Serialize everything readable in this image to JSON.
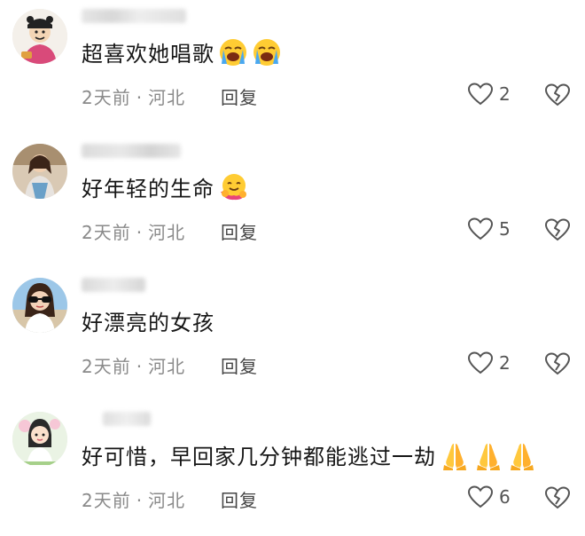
{
  "comments": [
    {
      "text": "超喜欢她唱歌",
      "emojis": [
        "loudly-crying-face-icon",
        "loudly-crying-face-icon"
      ],
      "time": "2天前",
      "location": "河北",
      "reply_label": "回复",
      "likes": "2"
    },
    {
      "text": "好年轻的生命",
      "emojis": [
        "hugging-face-icon"
      ],
      "time": "2天前",
      "location": "河北",
      "reply_label": "回复",
      "likes": "5"
    },
    {
      "text": "好漂亮的女孩",
      "emojis": [],
      "time": "2天前",
      "location": "河北",
      "reply_label": "回复",
      "likes": "2"
    },
    {
      "text": "好可惜，早回家几分钟都能逃过一劫",
      "emojis": [
        "folded-hands-icon",
        "folded-hands-icon",
        "folded-hands-icon"
      ],
      "time": "2天前",
      "location": "河北",
      "reply_label": "回复",
      "likes": "6"
    }
  ],
  "meta_separator": "·",
  "colors": {
    "meta_text": "#8a8a8a",
    "comment_text": "#161616",
    "icon_stroke": "#555555"
  }
}
